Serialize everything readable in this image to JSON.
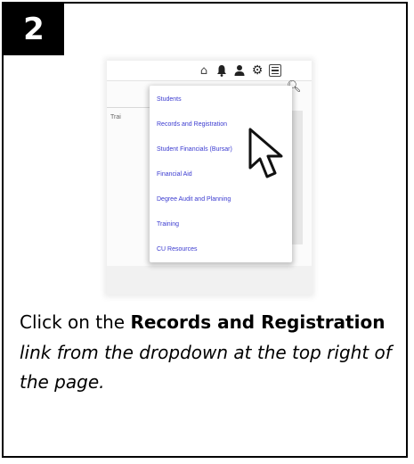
{
  "step": {
    "number": "2"
  },
  "screenshot": {
    "partial_text": "Trai",
    "icons": [
      "home-icon",
      "bell-icon",
      "user-icon",
      "gear-icon",
      "menu-icon"
    ],
    "dropdown_items": [
      "Students",
      "Records and Registration",
      "Student Financials (Bursar)",
      "Financial Aid",
      "Degree Audit and Planning",
      "Training",
      "CU Resources"
    ]
  },
  "instruction": {
    "prefix": "Click on the ",
    "bold": "Records and Registration",
    "italic": " link from the dropdown at the top right of the page."
  }
}
